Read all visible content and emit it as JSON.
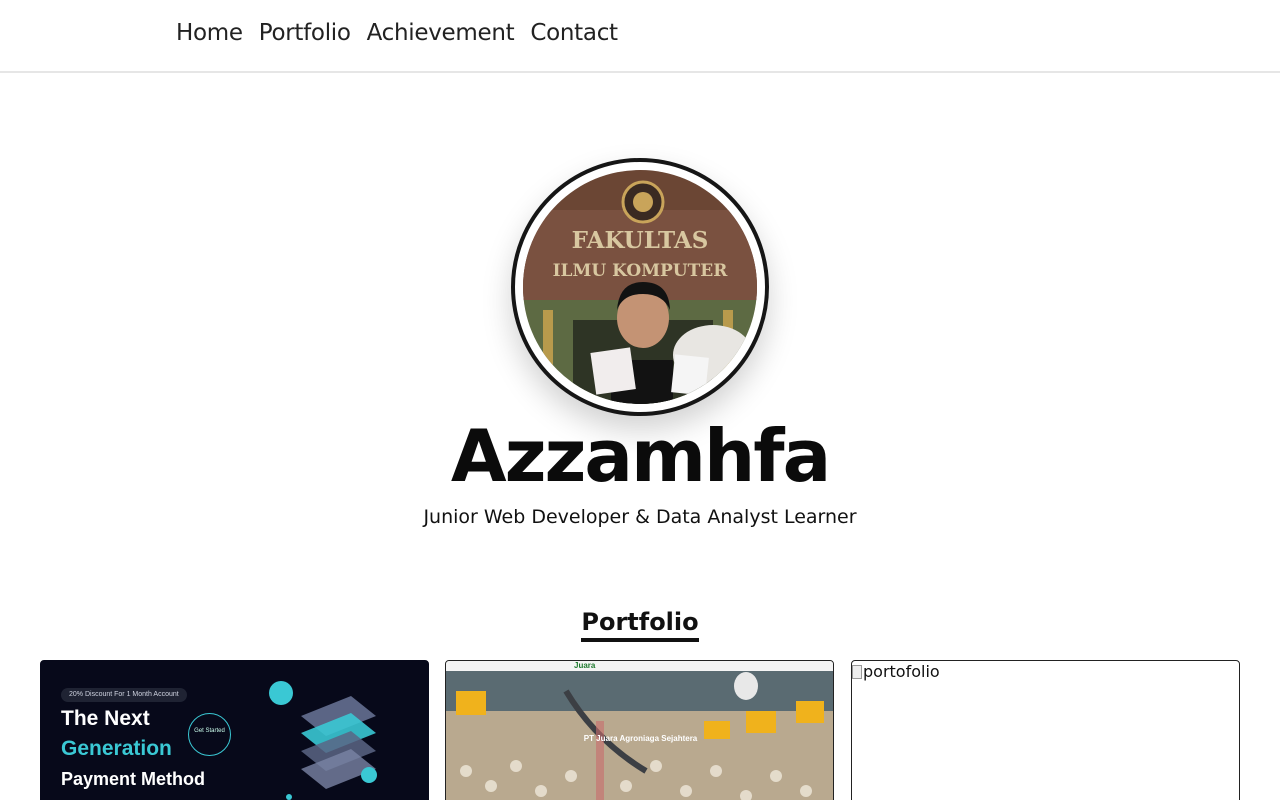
{
  "nav": {
    "items": [
      {
        "label": "Home"
      },
      {
        "label": "Portfolio"
      },
      {
        "label": "Achievement"
      },
      {
        "label": "Contact"
      }
    ]
  },
  "hero": {
    "name": "Azzamhfa",
    "subtitle": "Junior Web Developer & Data Analyst Learner",
    "avatar_sign_line1": "FAKULTAS",
    "avatar_sign_line2": "ILMU KOMPUTER"
  },
  "portfolio": {
    "title": "Portfolio",
    "cards": [
      {
        "badge": "20% Discount For 1 Month Account",
        "line1": "The Next",
        "line2": "Generation",
        "line3": "Payment Method",
        "cta": "Get Started"
      },
      {
        "site_name": "PT Juara Agroniaga Sejahtera",
        "logo": "Juara"
      },
      {
        "alt": "portofolio"
      }
    ]
  },
  "colors": {
    "accent_teal": "#3ac8d4",
    "card_dark": "#07091a",
    "text": "#111111"
  }
}
